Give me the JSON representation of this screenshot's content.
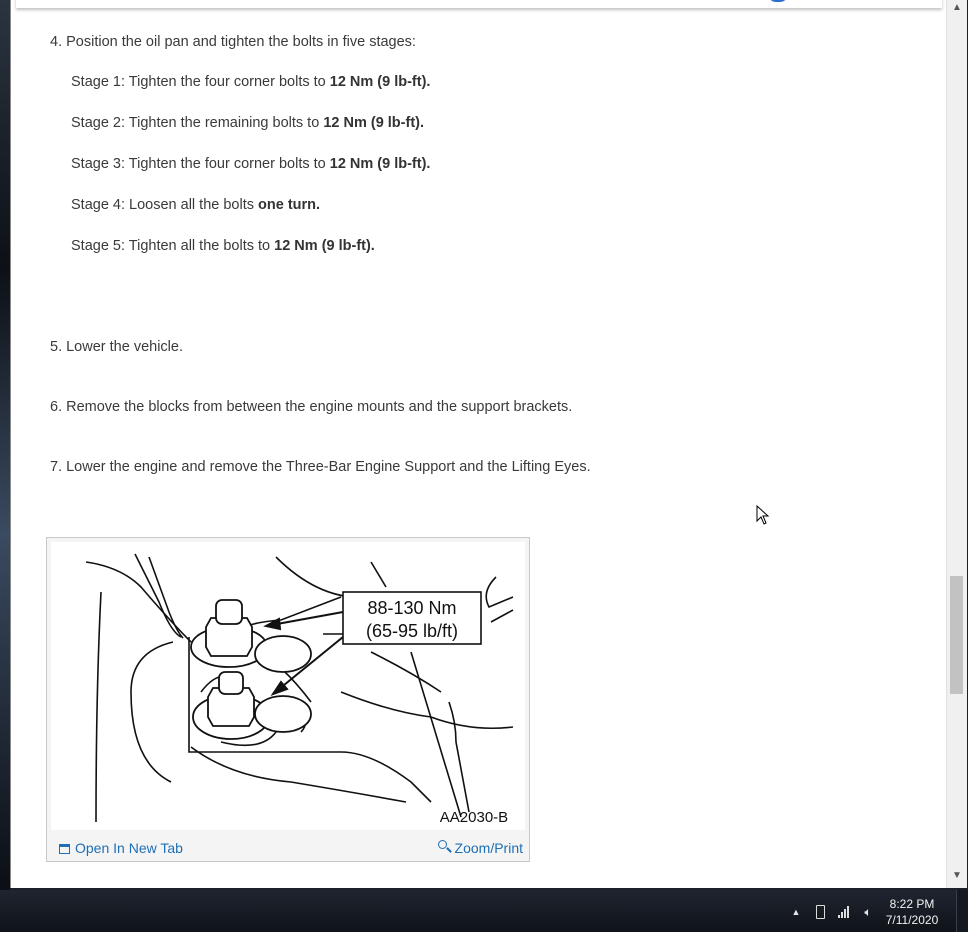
{
  "steps": {
    "step4": "4. Position the oil pan and tighten the bolts in five stages:",
    "stages": [
      {
        "prefix": "Stage 1: Tighten the four corner bolts to ",
        "bold": "12 Nm (9 lb-ft)."
      },
      {
        "prefix": "Stage 2: Tighten the remaining bolts to ",
        "bold": "12 Nm (9 lb-ft)."
      },
      {
        "prefix": "Stage 3: Tighten the four corner bolts to ",
        "bold": "12 Nm (9 lb-ft)."
      },
      {
        "prefix": "Stage 4: Loosen all the bolts ",
        "bold": "one turn."
      },
      {
        "prefix": "Stage 5: Tighten all the bolts to ",
        "bold": "12 Nm (9 lb-ft)."
      }
    ],
    "step5": "5. Lower the vehicle.",
    "step6": "6. Remove the blocks from between the engine mounts and the support brackets.",
    "step7": "7. Lower the engine and remove the Three-Bar Engine Support and the Lifting Eyes."
  },
  "figure": {
    "torque_line1": "88-130 Nm",
    "torque_line2": "(65-95 lb/ft)",
    "figure_id": "AA2030-B",
    "open_new_tab": "Open In New Tab",
    "zoom_print": "Zoom/Print"
  },
  "taskbar": {
    "time": "8:22 PM",
    "date": "7/11/2020",
    "icons": [
      "show-hidden-icon",
      "battery-icon",
      "signal-icon",
      "volume-icon"
    ]
  },
  "colors": {
    "link": "#1f6fb5",
    "text": "#3a3a3a",
    "taskbar": "#0f1319"
  }
}
